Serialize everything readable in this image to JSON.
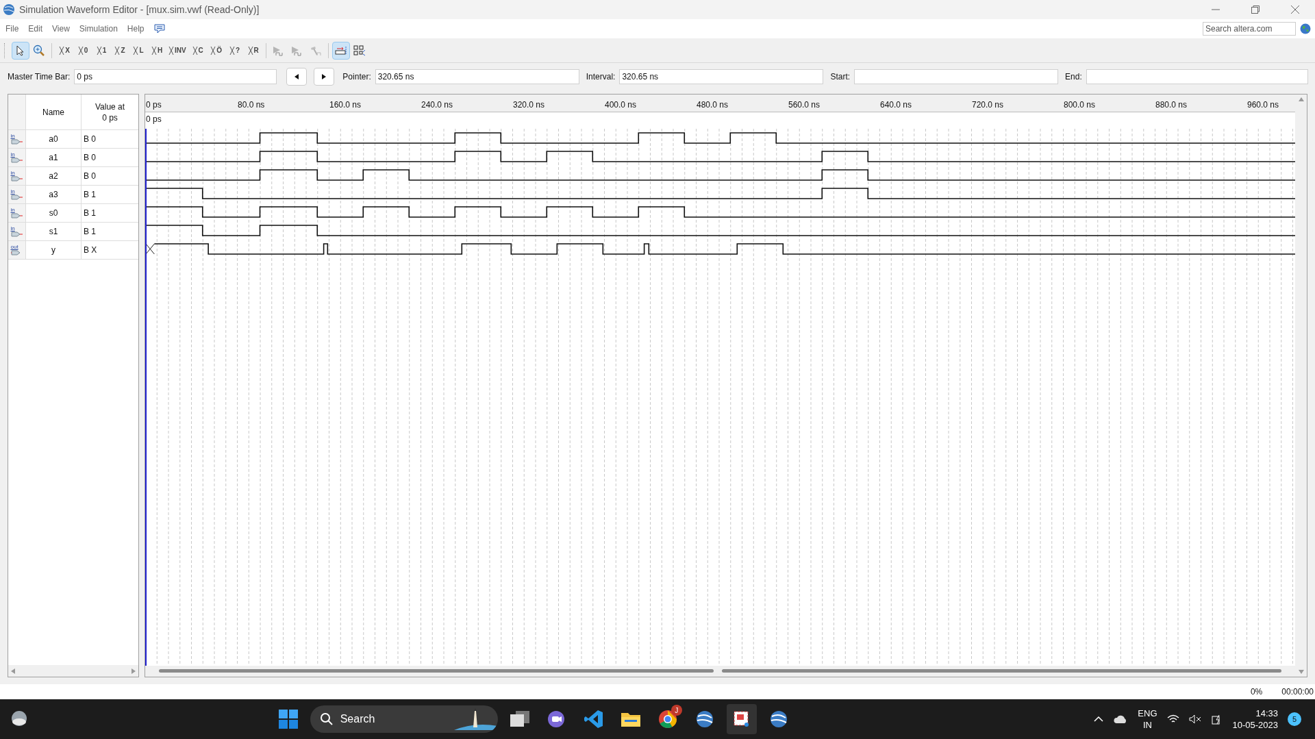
{
  "window": {
    "title": "Simulation Waveform Editor - [mux.sim.vwf (Read-Only)]"
  },
  "menu": [
    "File",
    "Edit",
    "View",
    "Simulation",
    "Help"
  ],
  "web_search": {
    "placeholder": "Search altera.com"
  },
  "toolbar": [
    {
      "kind": "select",
      "selected": true
    },
    {
      "kind": "zoom",
      "selected": false
    },
    {
      "kind": "sep"
    },
    {
      "kind": "glyph",
      "label": "X",
      "selected": false
    },
    {
      "kind": "glyph",
      "label": "0",
      "selected": false
    },
    {
      "kind": "glyph",
      "label": "1",
      "selected": false
    },
    {
      "kind": "glyph",
      "label": "Z",
      "selected": false
    },
    {
      "kind": "glyph",
      "label": "L",
      "selected": false
    },
    {
      "kind": "glyph",
      "label": "H",
      "selected": false
    },
    {
      "kind": "glyph",
      "label": "INV",
      "selected": false
    },
    {
      "kind": "glyph",
      "label": "C",
      "selected": false
    },
    {
      "kind": "glyph",
      "label": "Ö",
      "selected": false
    },
    {
      "kind": "glyph",
      "label": "?",
      "selected": false
    },
    {
      "kind": "glyph",
      "label": "R",
      "selected": false
    },
    {
      "kind": "sep"
    },
    {
      "kind": "run",
      "selected": false
    },
    {
      "kind": "run",
      "selected": false
    },
    {
      "kind": "debug",
      "selected": false
    },
    {
      "kind": "sep"
    },
    {
      "kind": "snap",
      "selected": true
    },
    {
      "kind": "grid",
      "selected": false
    }
  ],
  "time_bar": {
    "master_label": "Master Time Bar:",
    "master_value": "0 ps",
    "pointer_label": "Pointer:",
    "pointer_value": "320.65 ns",
    "interval_label": "Interval:",
    "interval_value": "320.65 ns",
    "start_label": "Start:",
    "end_label": "End:"
  },
  "signal_table": {
    "columns": [
      "Name",
      "Value at\n0 ps"
    ],
    "rows": [
      {
        "pin": "in",
        "name": "a0",
        "value": "B 0"
      },
      {
        "pin": "in",
        "name": "a1",
        "value": "B 0"
      },
      {
        "pin": "in",
        "name": "a2",
        "value": "B 0"
      },
      {
        "pin": "in",
        "name": "a3",
        "value": "B 1"
      },
      {
        "pin": "in",
        "name": "s0",
        "value": "B 1"
      },
      {
        "pin": "in",
        "name": "s1",
        "value": "B 1"
      },
      {
        "pin": "out",
        "name": "y",
        "value": "B X"
      }
    ]
  },
  "ruler": {
    "ticks": [
      "0 ps",
      "80.0 ns",
      "160.0 ns",
      "240.0 ns",
      "320.0 ns",
      "400.0 ns",
      "480.0 ns",
      "560.0 ns",
      "640.0 ns",
      "720.0 ns",
      "800.0 ns",
      "880.0 ns",
      "960.0 ns"
    ],
    "cursor_label": "0 ps"
  },
  "status_bar": {
    "progress": "0%",
    "elapsed": "00:00:00"
  },
  "taskbar": {
    "search": "Search",
    "language": "ENG",
    "region": "IN",
    "time": "14:33",
    "date": "10-05-2023",
    "notifications": "5",
    "chrome_badge": "J"
  }
}
